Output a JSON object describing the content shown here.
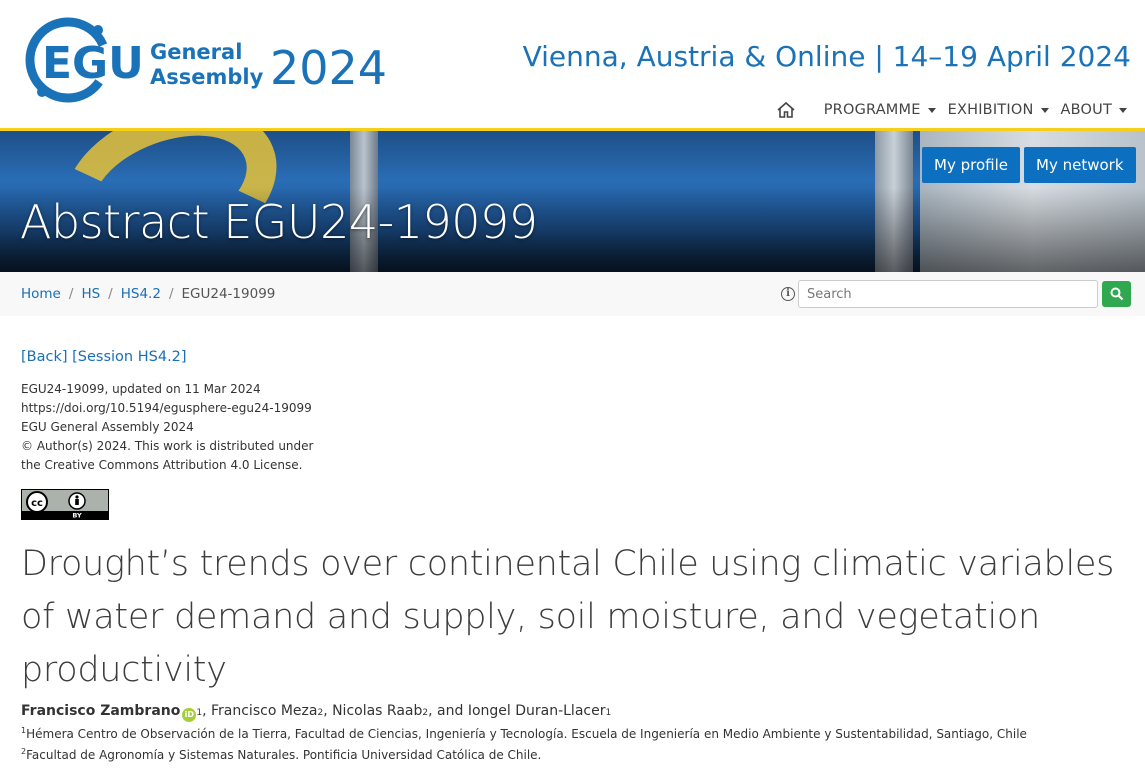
{
  "header": {
    "logo": {
      "egu": "EGU",
      "line1": "General",
      "line2": "Assembly",
      "year": "2024"
    },
    "event_info": "Vienna, Austria & Online | 14–19 April 2024",
    "nav": {
      "home_icon": "home-icon",
      "items": [
        "PROGRAMME",
        "EXHIBITION",
        "ABOUT"
      ]
    }
  },
  "banner": {
    "title": "Abstract EGU24-19099",
    "buttons": {
      "profile": "My profile",
      "network": "My network"
    }
  },
  "breadcrumb": {
    "items": [
      "Home",
      "HS",
      "HS4.2"
    ],
    "current": "EGU24-19099",
    "separator": "/"
  },
  "search": {
    "placeholder": "Search",
    "icon": "search-icon",
    "info_icon": "info-icon"
  },
  "colors": {
    "accent": "#1a73b8",
    "yellow_rule": "#f5cf1a",
    "button_blue": "#0d6fbf",
    "search_green": "#2fa84f"
  },
  "content": {
    "back": "[Back]",
    "session": "[Session HS4.2]",
    "meta": [
      "EGU24-19099, updated on 11 Mar 2024",
      "https://doi.org/10.5194/egusphere-egu24-19099",
      "EGU General Assembly 2024",
      "© Author(s) 2024. This work is distributed under",
      "the Creative Commons Attribution 4.0 License."
    ],
    "license_badge": {
      "cc": "cc",
      "by": "BY"
    },
    "title": "Drought’s trends over continental Chile using climatic variables of water demand and supply, soil moisture, and vegetation productivity",
    "authors": {
      "a1": "Francisco Zambrano",
      "a1_sup": "1",
      "a2": ", Francisco Meza",
      "a2_sup": "2",
      "a3": ", Nicolas Raab",
      "a3_sup": "2",
      "a4": ", and Iongel Duran-Llacer",
      "a4_sup": "1",
      "orcid": "iD"
    },
    "affiliations": [
      {
        "num": "1",
        "text": "Hémera Centro de Observación de la Tierra, Facultad de Ciencias, Ingeniería y Tecnología. Escuela de Ingeniería en Medio Ambiente y Sustentabilidad, Santiago, Chile"
      },
      {
        "num": "2",
        "text": "Facultad de Agronomía y Sistemas Naturales. Pontificia Universidad Católica de Chile."
      }
    ]
  }
}
